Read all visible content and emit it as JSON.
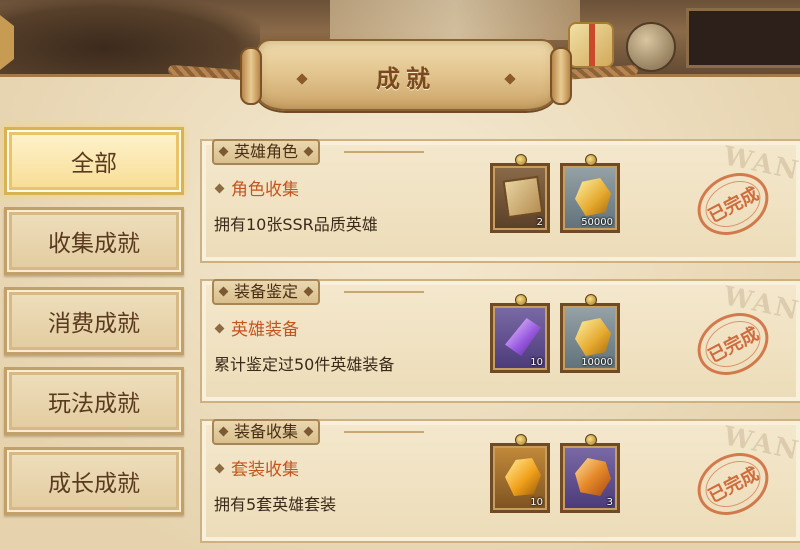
{
  "header": {
    "title": "成就"
  },
  "sidebar": {
    "items": [
      {
        "label": "全部",
        "active": true
      },
      {
        "label": "收集成就",
        "active": false
      },
      {
        "label": "消费成就",
        "active": false
      },
      {
        "label": "玩法成就",
        "active": false
      },
      {
        "label": "成长成就",
        "active": false
      }
    ]
  },
  "achievements": [
    {
      "category": "英雄角色",
      "name": "角色收集",
      "description": "拥有10张SSR品质英雄",
      "status": "已完成",
      "watermark": "WAN",
      "rewards": [
        {
          "icon": "scroll-icon",
          "count": "2"
        },
        {
          "icon": "gold-ore-icon",
          "count": "50000"
        }
      ]
    },
    {
      "category": "装备鉴定",
      "name": "英雄装备",
      "description": "累计鉴定过50件英雄装备",
      "status": "已完成",
      "watermark": "WAN",
      "rewards": [
        {
          "icon": "purple-crystal-icon",
          "count": "10"
        },
        {
          "icon": "gold-ore-icon",
          "count": "10000"
        }
      ]
    },
    {
      "category": "装备收集",
      "name": "套装收集",
      "description": "拥有5套英雄套装",
      "status": "已完成",
      "watermark": "WAN",
      "rewards": [
        {
          "icon": "amber-gem-icon",
          "count": "10"
        },
        {
          "icon": "orange-gem-icon",
          "count": "3"
        }
      ]
    }
  ]
}
